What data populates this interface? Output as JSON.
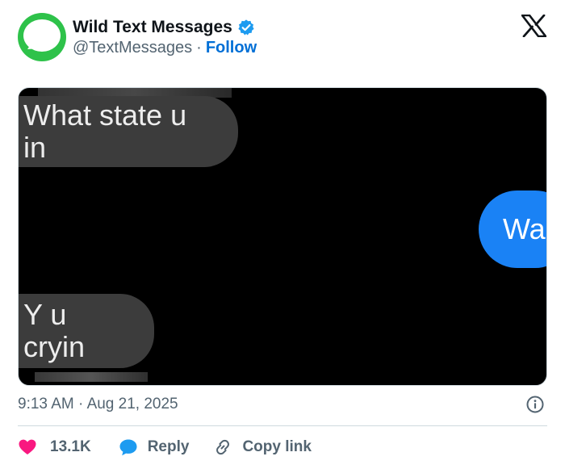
{
  "author": {
    "display_name": "Wild Text Messages",
    "handle": "@TextMessages",
    "separator": "·",
    "follow_label": "Follow",
    "verified": true,
    "avatar_icon": "message-bubble-icon",
    "avatar_color": "#2ec24a"
  },
  "media": {
    "messages": [
      {
        "side": "received",
        "text": "What state u in"
      },
      {
        "side": "sent",
        "text": "Wa"
      },
      {
        "side": "received",
        "text": "Y u cryin"
      }
    ],
    "sent_color": "#1a82f5",
    "received_color": "#3c3c3c"
  },
  "meta": {
    "time": "9:13 AM",
    "separator": "·",
    "date": "Aug 21, 2025"
  },
  "actions": {
    "like_count": "13.1K",
    "reply_label": "Reply",
    "copy_label": "Copy link",
    "like_color": "#f91880",
    "reply_color": "#1d9bf0"
  }
}
